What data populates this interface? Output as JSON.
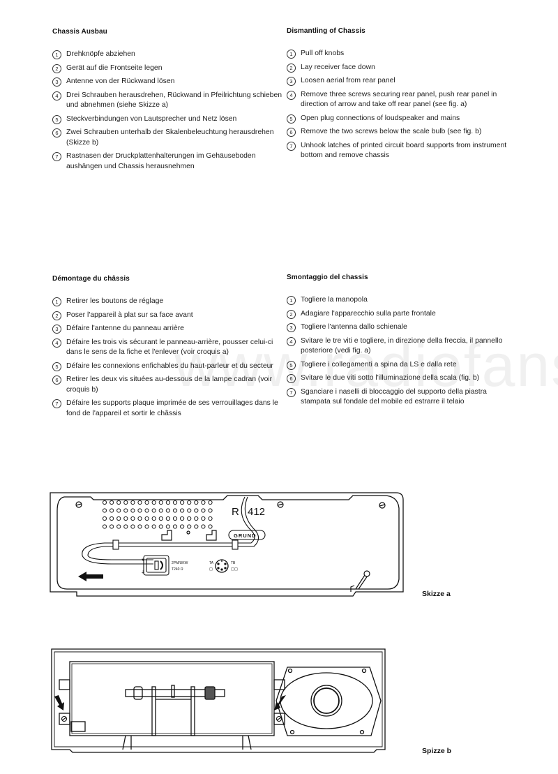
{
  "sections": {
    "de": {
      "title": "Chassis Ausbau",
      "steps": [
        {
          "num": "1",
          "text": "Drehknöpfe abziehen"
        },
        {
          "num": "2",
          "text": "Gerät auf die Frontseite legen"
        },
        {
          "num": "3",
          "text": "Antenne von der Rückwand lösen"
        },
        {
          "num": "4",
          "text": "Drei Schrauben herausdrehen, Rückwand in Pfeilrichtung schieben und abnehmen (siehe Skizze a)"
        },
        {
          "num": "5",
          "text": "Steckverbindungen von Lautsprecher und Netz lösen"
        },
        {
          "num": "6",
          "text": "Zwei Schrauben unterhalb der Skalenbeleuchtung herausdrehen (Skizze b)"
        },
        {
          "num": "7",
          "text": "Rastnasen der Druckplattenhalterungen im Gehäuseboden aushängen und Chassis herausnehmen"
        }
      ]
    },
    "en": {
      "title": "Dismantling of Chassis",
      "steps": [
        {
          "num": "1",
          "text": "Pull off knobs"
        },
        {
          "num": "2",
          "text": "Lay receiver face down"
        },
        {
          "num": "3",
          "text": "Loosen aerial from rear panel"
        },
        {
          "num": "4",
          "text": "Remove three screws securing rear panel, push rear panel in direction of arrow and take off rear panel (see fig. a)"
        },
        {
          "num": "5",
          "text": "Open plug connections of loudspeaker and mains"
        },
        {
          "num": "6",
          "text": "Remove the two screws below the scale bulb (see fig. b)"
        },
        {
          "num": "7",
          "text": "Unhook latches of printed circuit board supports from instrument bottom and remove chassis"
        }
      ]
    },
    "fr": {
      "title": "Démontage du châssis",
      "steps": [
        {
          "num": "1",
          "text": "Retirer les boutons de réglage"
        },
        {
          "num": "2",
          "text": "Poser l'appareil à plat sur sa face avant"
        },
        {
          "num": "3",
          "text": "Défaire l'antenne du panneau arrière"
        },
        {
          "num": "4",
          "text": "Défaire les trois vis sécurant le panneau-arrière, pousser celui-ci dans le sens de la fiche et l'enlever (voir croquis a)"
        },
        {
          "num": "5",
          "text": "Défaire les connexions enfichables du haut-parleur et du secteur"
        },
        {
          "num": "6",
          "text": "Retirer les deux vis situées au-dessous de la lampe cadran (voir croquis b)"
        },
        {
          "num": "7",
          "text": "Défaire les supports plaque imprimée de ses verrouillages dans le fond de l'appareil et sortir le châssis"
        }
      ]
    },
    "it": {
      "title": "Smontaggio del chassis",
      "steps": [
        {
          "num": "1",
          "text": "Togliere la manopola"
        },
        {
          "num": "2",
          "text": "Adagiare l'apparecchio sulla parte frontale"
        },
        {
          "num": "3",
          "text": "Togliere l'antenna dallo schienale"
        },
        {
          "num": "4",
          "text": "Svitare le tre viti e togliere, in direzione della freccia, il pannello posteriore (vedi fig. a)"
        },
        {
          "num": "5",
          "text": "Togliere i collegamenti a spina da LS e dalla rete"
        },
        {
          "num": "6",
          "text": "Svitare le due viti sotto l'illuminazione della scala (fig. b)"
        },
        {
          "num": "7",
          "text": "Sganciare i naselli di bloccaggio del supporto della piastra stampata sul fondale del mobile ed estrarre il telaio"
        }
      ]
    }
  },
  "figures": {
    "a": {
      "caption": "Skizze a",
      "model_label_left": "R",
      "model_label_right": "412",
      "brand_label": "GRUND",
      "socket_label_line1": "2PM/UKW",
      "socket_label_line2": "T240 Ω",
      "din_label_left": "TA",
      "din_label_right": "TB",
      "vent_rows": 4,
      "vent_cols": 16
    },
    "b": {
      "caption": "Spizze b"
    }
  },
  "watermark": "www.radiofans.cn"
}
